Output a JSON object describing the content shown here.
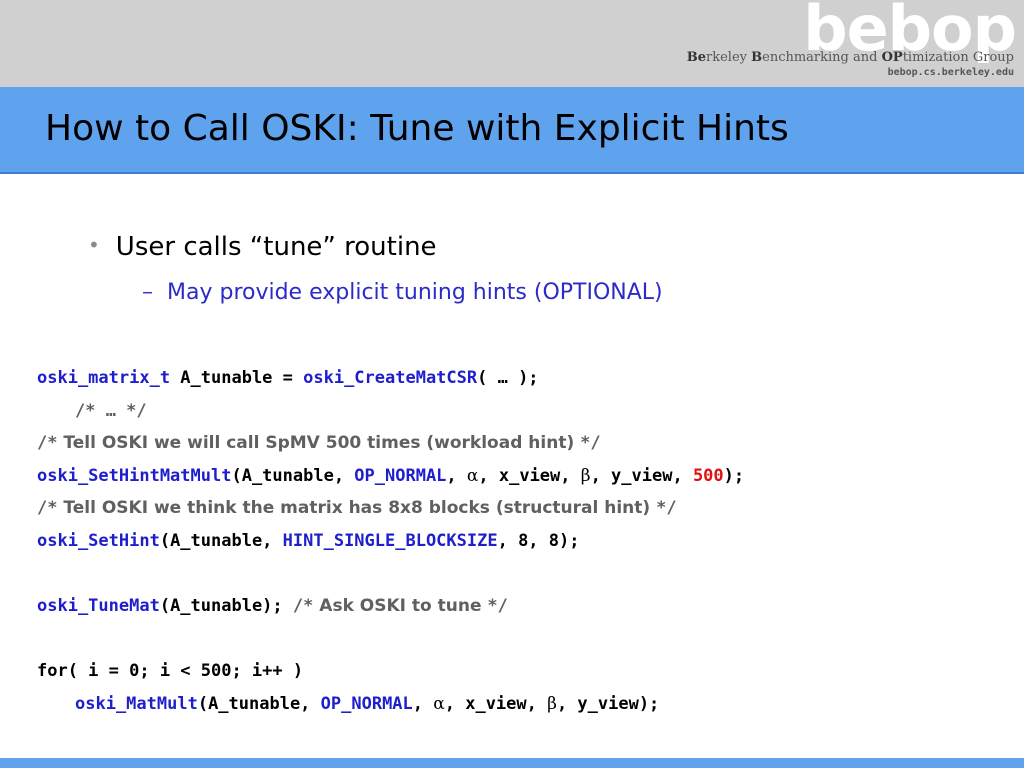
{
  "header": {
    "logo": "bebop",
    "group_name_b1": "Be",
    "group_name_t1": "rkeley ",
    "group_name_b2": "B",
    "group_name_t2": "enchmarking and ",
    "group_name_b3": "OP",
    "group_name_t3": "timization Group",
    "url": "bebop.cs.berkeley.edu"
  },
  "slide": {
    "title": "How to Call OSKI: Tune with Explicit Hints",
    "bullet1": "User calls “tune” routine",
    "bullet2": "May provide explicit tuning hints (OPTIONAL)"
  },
  "code": {
    "l1_type": "oski_matrix_t",
    "l1_mid": " A_tunable = ",
    "l1_fn": "oski_CreateMatCSR",
    "l1_end": "( … );",
    "l2": "/* … */",
    "l3_open": "/*",
    "l3_text": " Tell OSKI we will call SpMV 500 times (workload hint) ",
    "l3_close": "*/",
    "l4_fn": "oski_SetHintMatMult",
    "l4_a": "(A_tunable, ",
    "l4_op": "OP_NORMAL",
    "l4_b": ", ",
    "l4_alpha": "α",
    "l4_c": ", x_view, ",
    "l4_beta": "β",
    "l4_d": ", y_view, ",
    "l4_num": "500",
    "l4_end": ");",
    "l5_open": "/*",
    "l5_text": " Tell OSKI we think the matrix has 8x8 blocks (structural hint) ",
    "l5_close": "*/",
    "l6_fn": "oski_SetHint",
    "l6_a": "(A_tunable, ",
    "l6_hint": "HINT_SINGLE_BLOCKSIZE",
    "l6_end": ", 8, 8);",
    "l7_fn": "oski_TuneMat",
    "l7_a": "(A_tunable); ",
    "l7_open": "/*",
    "l7_text": " Ask OSKI to tune ",
    "l7_close": "*/",
    "l8": "for( i = 0; i < 500; i++ )",
    "l9_fn": "oski_MatMult",
    "l9_a": "(A_tunable, ",
    "l9_op": "OP_NORMAL",
    "l9_b": ", ",
    "l9_alpha": "α",
    "l9_c": ", x_view, ",
    "l9_beta": "β",
    "l9_end": ", y_view);"
  }
}
